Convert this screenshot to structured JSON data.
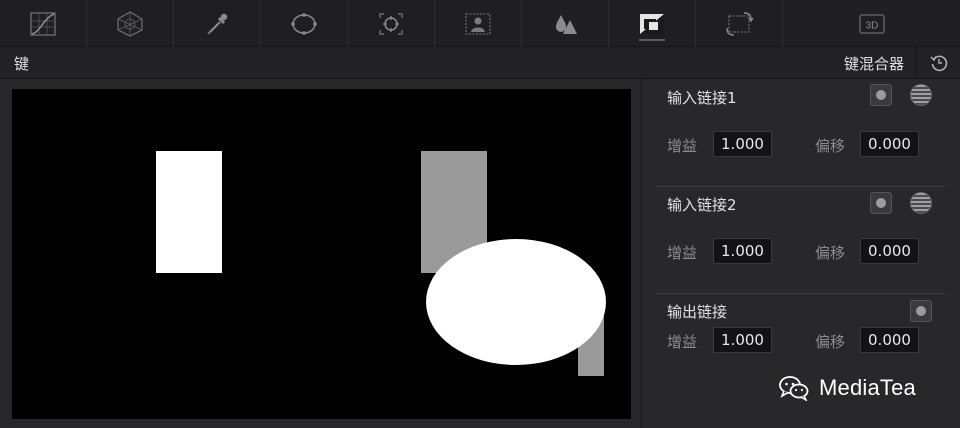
{
  "toolbar": {
    "tools": [
      {
        "icon": "curves-icon"
      },
      {
        "icon": "color-warper-icon"
      },
      {
        "icon": "qualifier-eyedropper-icon"
      },
      {
        "icon": "power-window-icon"
      },
      {
        "icon": "tracker-icon"
      },
      {
        "icon": "magic-mask-icon"
      },
      {
        "icon": "blur-icon"
      },
      {
        "icon": "key-icon",
        "active": true
      },
      {
        "icon": "sizing-icon"
      },
      {
        "icon": "3d-icon",
        "label": "3D"
      }
    ]
  },
  "header": {
    "left_title": "键",
    "right_title": "键混合器",
    "reset_icon": "reset-icon"
  },
  "panel": {
    "input1": {
      "title": "输入链接1",
      "gain_label": "增益",
      "gain": "1.000",
      "offset_label": "偏移",
      "offset": "0.000"
    },
    "input2": {
      "title": "输入链接2",
      "gain_label": "增益",
      "gain": "1.000",
      "offset_label": "偏移",
      "offset": "0.000"
    },
    "output": {
      "title": "输出链接",
      "gain_label": "增益",
      "gain": "1.000",
      "offset_label": "偏移",
      "offset": "0.000"
    }
  },
  "watermark": {
    "text": "MediaTea",
    "icon": "wechat-icon"
  }
}
